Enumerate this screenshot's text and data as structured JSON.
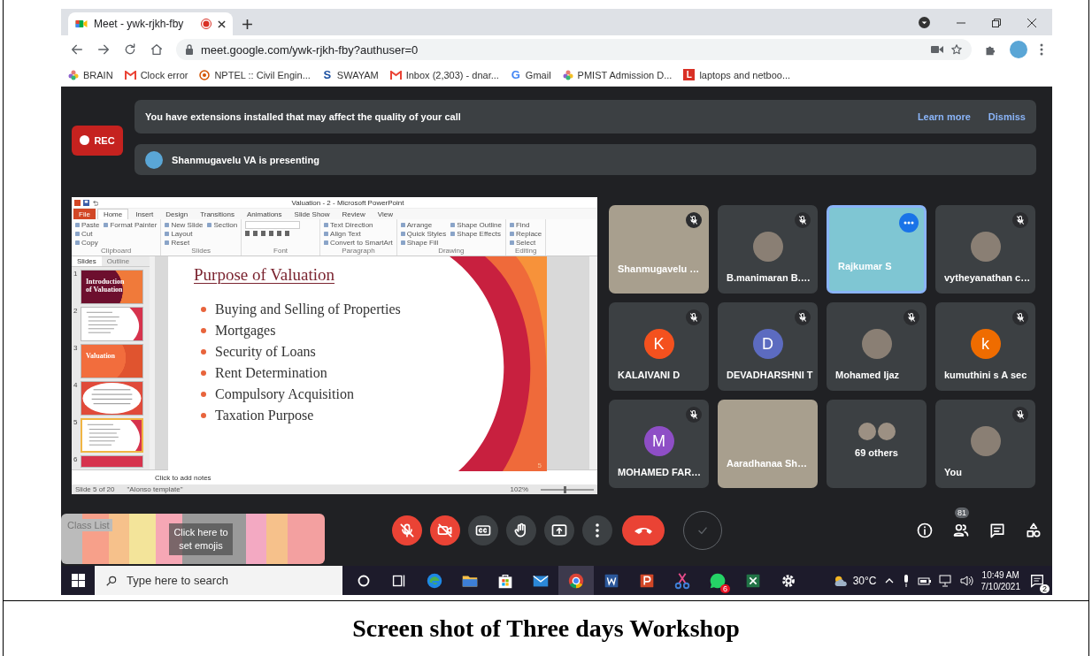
{
  "browser": {
    "tab": {
      "title": "Meet - ywk-rjkh-fby",
      "recording": true
    },
    "url": "meet.google.com/ywk-rjkh-fby?authuser=0",
    "bookmarks": [
      {
        "label": "BRAIN",
        "kind": "flower"
      },
      {
        "label": "Clock error",
        "kind": "gmail"
      },
      {
        "label": "NPTEL :: Civil Engin...",
        "kind": "nptel"
      },
      {
        "label": "SWAYAM",
        "kind": "letter",
        "icon_text": "S",
        "color": "#1a4fa0"
      },
      {
        "label": "Inbox (2,303) - dnar...",
        "kind": "gmail"
      },
      {
        "label": "Gmail",
        "kind": "letter",
        "icon_text": "G",
        "color": "#4285f4"
      },
      {
        "label": "PMIST Admission D...",
        "kind": "flower"
      },
      {
        "label": "laptops and netboo...",
        "kind": "badge",
        "icon_text": "L",
        "color": "#d93025"
      }
    ]
  },
  "meet": {
    "rec": "REC",
    "banner": {
      "text": "You have extensions installed that may affect the quality of your call",
      "actions": [
        "Learn more",
        "Dismiss"
      ]
    },
    "presenting": "Shanmugavelu VA is presenting",
    "presentation": {
      "window_title": "Valuation - 2 - Microsoft PowerPoint",
      "ribbon_tabs": [
        {
          "label": "File",
          "kind": "file",
          "selected": false
        },
        {
          "label": "Home",
          "kind": "tab",
          "selected": true
        },
        {
          "label": "Insert",
          "kind": "tab",
          "selected": false
        },
        {
          "label": "Design",
          "kind": "tab",
          "selected": false
        },
        {
          "label": "Transitions",
          "kind": "tab",
          "selected": false
        },
        {
          "label": "Animations",
          "kind": "tab",
          "selected": false
        },
        {
          "label": "Slide Show",
          "kind": "tab",
          "selected": false
        },
        {
          "label": "Review",
          "kind": "tab",
          "selected": false
        },
        {
          "label": "View",
          "kind": "tab",
          "selected": false
        }
      ],
      "ribbon_groups": [
        {
          "label": "Clipboard",
          "items": [
            "Paste",
            "Cut",
            "Copy",
            "Format Painter"
          ]
        },
        {
          "label": "Slides",
          "items": [
            "New Slide",
            "Layout",
            "Reset",
            "Section"
          ]
        },
        {
          "label": "Font"
        },
        {
          "label": "Paragraph",
          "items": [
            "Text Direction",
            "Align Text",
            "Convert to SmartArt"
          ]
        },
        {
          "label": "Drawing",
          "items": [
            "Arrange",
            "Quick Styles",
            "Shape Fill",
            "Shape Outline",
            "Shape Effects"
          ]
        },
        {
          "label": "Editing",
          "items": [
            "Find",
            "Replace",
            "Select"
          ]
        }
      ],
      "panel_tabs": [
        {
          "label": "Slides",
          "selected": true
        },
        {
          "label": "Outline",
          "selected": false
        }
      ],
      "thumbnails": [
        {
          "number": "1",
          "kind": "title",
          "text": "Introduction of Valuation",
          "selected": false
        },
        {
          "number": "2",
          "kind": "text",
          "selected": false
        },
        {
          "number": "3",
          "kind": "section",
          "text": "Valuation",
          "selected": false
        },
        {
          "number": "4",
          "kind": "circle",
          "selected": false
        },
        {
          "number": "5",
          "kind": "text",
          "selected": true
        },
        {
          "number": "6",
          "kind": "partial",
          "selected": false
        }
      ],
      "slide": {
        "title": "Purpose of Valuation",
        "bullets": [
          "Buying and Selling of Properties",
          "Mortgages",
          "Security of Loans",
          "Rent Determination",
          "Compulsory Acquisition",
          "Taxation Purpose"
        ],
        "number": "5"
      },
      "notes_placeholder": "Click to add notes",
      "status": {
        "slide": "Slide 5 of 20",
        "theme": "\"Alonso template\"",
        "zoom": "102%",
        "zoom_slider": {
          "level": 0.45
        }
      }
    },
    "participants": [
      {
        "name": "Shanmugavelu …",
        "kind": "video",
        "muted": true,
        "selected": false
      },
      {
        "name": "B.manimaran B.…",
        "kind": "photo",
        "muted": true,
        "selected": false
      },
      {
        "name": "Rajkumar S",
        "kind": "video",
        "muted": false,
        "selected": true
      },
      {
        "name": "vytheyanathan c…",
        "kind": "photo",
        "muted": true,
        "selected": false
      },
      {
        "name": "KALAIVANI D",
        "kind": "initial",
        "initial": "K",
        "color": "#f4511e",
        "muted": true,
        "selected": false
      },
      {
        "name": "DEVADHARSHNI T",
        "kind": "initial",
        "initial": "D",
        "color": "#5c6bc0",
        "muted": true,
        "selected": false
      },
      {
        "name": "Mohamed Ijaz",
        "kind": "photo",
        "muted": true,
        "selected": false
      },
      {
        "name": "kumuthini s A sec",
        "kind": "initial",
        "initial": "k",
        "color": "#ef6c00",
        "muted": true,
        "selected": false
      },
      {
        "name": "MOHAMED FAR…",
        "kind": "initial",
        "initial": "M",
        "color": "#8e4ec6",
        "muted": true,
        "selected": false
      },
      {
        "name": "Aaradhanaa Sh…",
        "kind": "video",
        "muted": false,
        "selected": false
      },
      {
        "name": "69 others",
        "kind": "group",
        "muted": false,
        "selected": false
      },
      {
        "name": "You",
        "kind": "photo",
        "muted": true,
        "selected": false
      }
    ],
    "controls": [
      {
        "kind": "mic",
        "on": false
      },
      {
        "kind": "camera",
        "on": false
      },
      {
        "kind": "captions",
        "on": false
      },
      {
        "kind": "hand",
        "on": false
      },
      {
        "kind": "present",
        "on": false
      },
      {
        "kind": "more",
        "on": false
      },
      {
        "kind": "end"
      },
      {
        "kind": "ring"
      }
    ],
    "side_controls": [
      {
        "kind": "info"
      },
      {
        "kind": "people",
        "badge": "81"
      },
      {
        "kind": "chat"
      },
      {
        "kind": "activities"
      }
    ],
    "emoji_overlay": {
      "label": "Click here to set emojis",
      "behind": "Class List"
    }
  },
  "taskbar": {
    "search_placeholder": "Type here to search",
    "apps": [
      {
        "kind": "cortana",
        "active": false
      },
      {
        "kind": "taskview",
        "active": false
      },
      {
        "kind": "edge",
        "active": false
      },
      {
        "kind": "folder",
        "active": false
      },
      {
        "kind": "store",
        "active": false
      },
      {
        "kind": "mail",
        "active": false
      },
      {
        "kind": "chrome",
        "active": true
      },
      {
        "kind": "word",
        "active": false
      },
      {
        "kind": "powerpoint",
        "active": false
      },
      {
        "kind": "snip",
        "active": false
      },
      {
        "kind": "whatsapp",
        "active": false,
        "badge": "6"
      },
      {
        "kind": "excel",
        "active": false
      },
      {
        "kind": "gear",
        "active": false
      }
    ],
    "weather": "30°C",
    "time": "10:49 AM",
    "date": "7/10/2021",
    "notifications": "2"
  },
  "caption": "Screen shot of Three days Workshop"
}
